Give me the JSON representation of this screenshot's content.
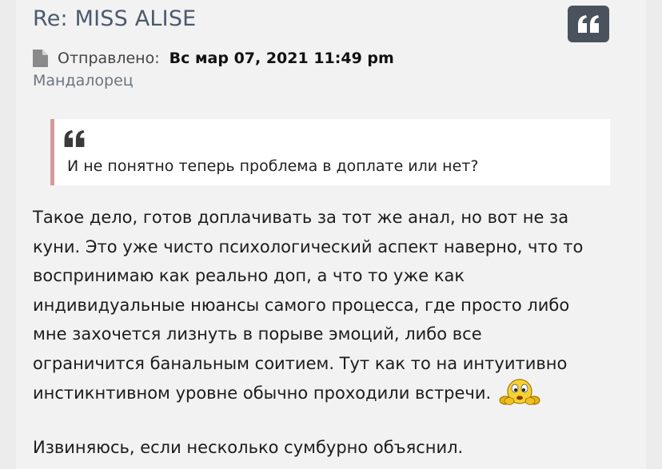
{
  "post": {
    "title": "Re: MISS ALISE",
    "quote_button_icon": "quote-icon",
    "meta": {
      "icon": "file-icon",
      "label": "Отправлено",
      "date": "Вс мар 07, 2021 11:49 pm"
    },
    "author": "Мандалорец",
    "blockquote": {
      "icon": "quote-icon",
      "text": "И не понятно теперь проблема в доплате или нет?"
    },
    "body": {
      "paragraph1_lines": [
        "Такое дело, готов доплачивать за тот же анал, но вот не за",
        "куни. Это уже чисто психологический аспект наверно, что то",
        "воспринимаю как реально доп, а что то уже как",
        "индивидуальные нюансы самого процесса, где просто либо",
        "мне захочется лизнуть в порыве эмоций, либо все",
        "ограничится банальным соитием. Тут как то на интуитивно",
        "инстикнтивном уровне обычно проходили встречи."
      ],
      "emoji": "thinking-smiley-icon",
      "paragraph2": "Извиняюсь, если несколько сумбурно объяснил."
    }
  },
  "colors": {
    "title": "#4b5a6d",
    "quote_button_bg": "#4a525d",
    "blockquote_border": "#d39a9a",
    "author": "#6b7581"
  }
}
